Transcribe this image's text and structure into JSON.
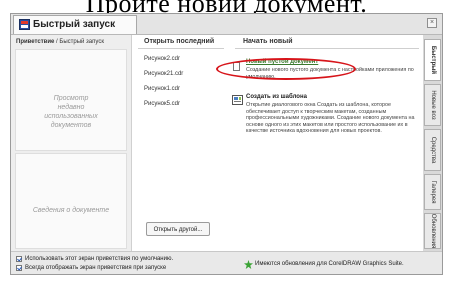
{
  "caption": "Пройте новий документ.",
  "window": {
    "title": "Быстрый запуск",
    "close_glyph": "×"
  },
  "left_panel": {
    "breadcrumb_current": "Приветствие",
    "breadcrumb_rest": " / Быстрый запуск",
    "preview_placeholder": "Просмотр\nнедавно\nиспользованных\nдокументов",
    "docinfo_placeholder": "Сведения о документе"
  },
  "recent": {
    "header": "Открыть последний",
    "files": [
      "Рисунок2.cdr",
      "Рисунок21.cdr",
      "Рисунок1.cdr",
      "Рисунок5.cdr"
    ],
    "open_other_label": "Открыть другой..."
  },
  "start_new": {
    "header": "Начать новый",
    "new_doc_link": "Новый пустой документ",
    "new_doc_desc": "Создание нового пустого документа с настройками приложения по умолчанию.",
    "from_template_title": "Создать из шаблона",
    "from_template_desc": "Открытие диалогового окна Создать из шаблона, которое обеспечивает доступ к творческим макетам, созданным профессиональными художниками. Создание нового документа на основе одного из этих макетов или простого использование их в качестве источника вдохновения для новых проектов."
  },
  "side_tabs": [
    "Быстрый",
    "Новые воз",
    "Средства",
    "Галерея",
    "Обновления"
  ],
  "footer": {
    "checkbox1_label": "Использовать этот экран приветствия по умолчанию.",
    "checkbox2_label": "Всегда отображать экран приветствия при запуске",
    "update_text": "Имеются обновления для CorelDRAW Graphics Suite."
  },
  "colors": {
    "highlight_ellipse": "#d7141a",
    "link_green": "#3a7a2e"
  }
}
